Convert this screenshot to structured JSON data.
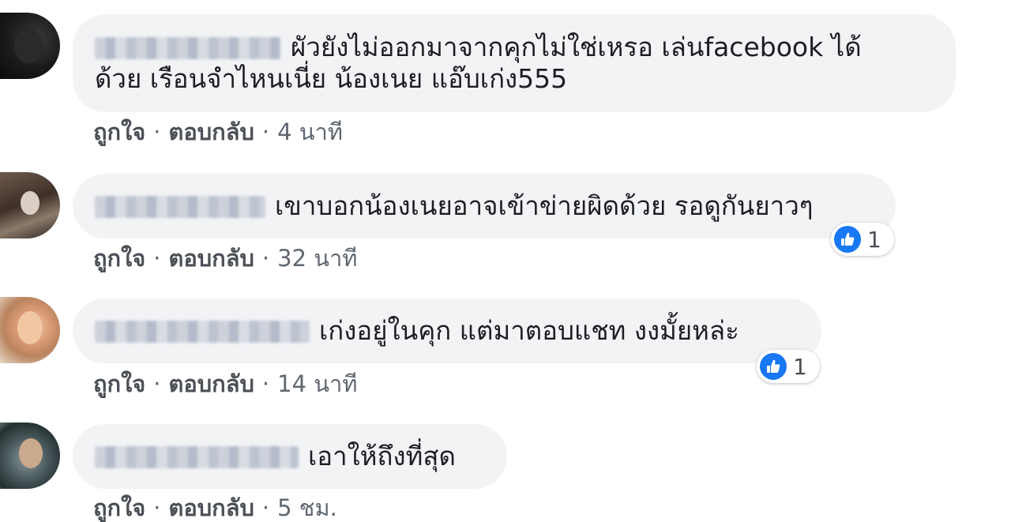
{
  "comments": [
    {
      "text_line1": "ผัวยังไม่ออกมาจากคุกไม่ใช่เหรอ เล่นfacebook ได้",
      "text_line2": "ด้วย เรือนจำไหนเนี่ย น้องเนย แอ๊บเก่ง555",
      "like_label": "ถูกใจ",
      "reply_label": "ตอบกลับ",
      "separator": "·",
      "time": "4 นาที"
    },
    {
      "text": "เขาบอกน้องเนยอาจเข้าข่ายผิดด้วย รอดูกันยาวๆ",
      "like_label": "ถูกใจ",
      "reply_label": "ตอบกลับ",
      "separator": "·",
      "time": "32 นาที",
      "reaction_count": "1"
    },
    {
      "text": "เก่งอยู่ในคุก แต่มาตอบแชท งงมั้ยหล่ะ",
      "like_label": "ถูกใจ",
      "reply_label": "ตอบกลับ",
      "separator": "·",
      "time": "14 นาที",
      "reaction_count": "1"
    },
    {
      "text": "เอาให้ถึงที่สุด",
      "like_label": "ถูกใจ",
      "reply_label": "ตอบกลับ",
      "separator": "·",
      "time": "5 ชม."
    }
  ],
  "colors": {
    "bubble_bg": "#f2f3f5",
    "text": "#1c1e21",
    "meta": "#606770",
    "like_blue": "#1877f2"
  },
  "icons": {
    "reaction": "like-thumb-icon"
  }
}
